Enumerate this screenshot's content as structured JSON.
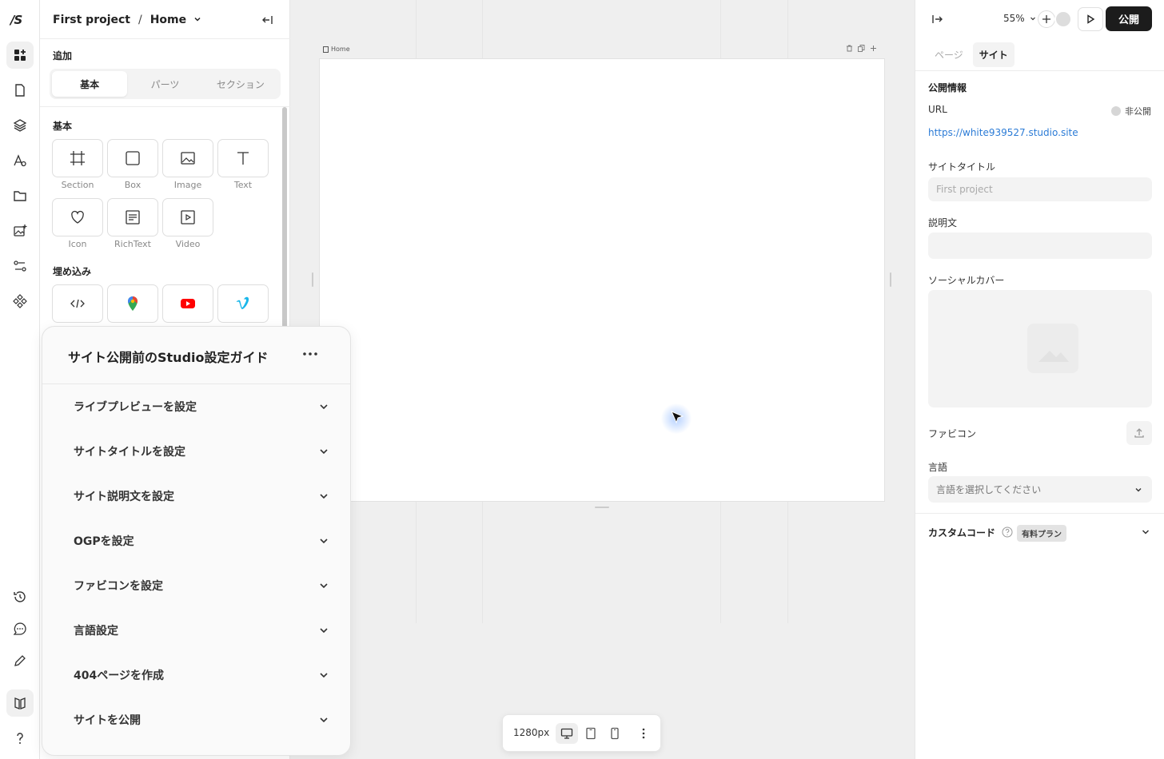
{
  "rail": {
    "logo": "/S",
    "items": [
      {
        "name": "add-elements-icon",
        "active": true
      },
      {
        "name": "pages-icon"
      },
      {
        "name": "layers-icon"
      },
      {
        "name": "typography-icon"
      },
      {
        "name": "folder-icon"
      },
      {
        "name": "image-add-icon"
      },
      {
        "name": "cms-icon"
      },
      {
        "name": "components-icon"
      }
    ],
    "bottom_items": [
      "history-icon",
      "chat-icon",
      "edit-icon",
      "guide-book-icon",
      "help-icon"
    ]
  },
  "left_panel": {
    "project": "First project",
    "separator": "/",
    "page": "Home",
    "add_label": "追加",
    "tabs": [
      "基本",
      "パーツ",
      "セクション"
    ],
    "basic_label": "基本",
    "basic_items": [
      "Section",
      "Box",
      "Image",
      "Text",
      "Icon",
      "RichText",
      "Video"
    ],
    "embed_label": "埋め込み"
  },
  "guide": {
    "title": "サイト公開前のStudio設定ガイド",
    "items": [
      "ライブプレビューを設定",
      "サイトタイトルを設定",
      "サイト説明文を設定",
      "OGPを設定",
      "ファビコンを設定",
      "言語設定",
      "404ページを作成",
      "サイトを公開"
    ]
  },
  "canvas": {
    "frame_label": "Home",
    "width_label": "1280px"
  },
  "right_panel": {
    "zoom": "55%",
    "publish": "公開",
    "tabs": [
      "ページ",
      "サイト"
    ],
    "section_title": "公開情報",
    "url_label": "URL",
    "status": "非公開",
    "url": "https://white939527.studio.site",
    "site_title_label": "サイトタイトル",
    "site_title_placeholder": "First project",
    "description_label": "説明文",
    "social_cover_label": "ソーシャルカバー",
    "favicon_label": "ファビコン",
    "language_label": "言語",
    "language_placeholder": "言語を選択してください",
    "custom_code_label": "カスタムコード",
    "paid_plan_badge": "有料プラン"
  },
  "colors": {
    "accent_link": "#2b7bd6",
    "publish_bg": "#1c1c1c",
    "youtube": "#ff0000",
    "vimeo": "#1ab7ea"
  }
}
